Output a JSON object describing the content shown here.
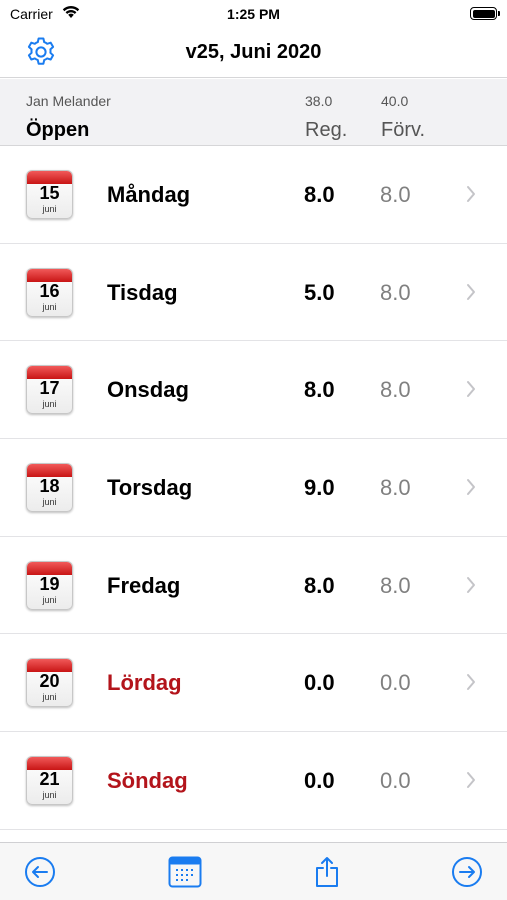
{
  "status_bar": {
    "carrier": "Carrier",
    "time": "1:25 PM"
  },
  "nav": {
    "title": "v25, Juni 2020"
  },
  "summary": {
    "name": "Jan Melander",
    "status": "Öppen",
    "reg_total": "38.0",
    "forv_total": "40.0",
    "reg_label": "Reg.",
    "forv_label": "Förv."
  },
  "days": [
    {
      "date": "15",
      "month": "juni",
      "name": "Måndag",
      "reg": "8.0",
      "forv": "8.0",
      "weekend": false
    },
    {
      "date": "16",
      "month": "juni",
      "name": "Tisdag",
      "reg": "5.0",
      "forv": "8.0",
      "weekend": false
    },
    {
      "date": "17",
      "month": "juni",
      "name": "Onsdag",
      "reg": "8.0",
      "forv": "8.0",
      "weekend": false
    },
    {
      "date": "18",
      "month": "juni",
      "name": "Torsdag",
      "reg": "9.0",
      "forv": "8.0",
      "weekend": false
    },
    {
      "date": "19",
      "month": "juni",
      "name": "Fredag",
      "reg": "8.0",
      "forv": "8.0",
      "weekend": false
    },
    {
      "date": "20",
      "month": "juni",
      "name": "Lördag",
      "reg": "0.0",
      "forv": "0.0",
      "weekend": true
    },
    {
      "date": "21",
      "month": "juni",
      "name": "Söndag",
      "reg": "0.0",
      "forv": "0.0",
      "weekend": true
    }
  ],
  "colors": {
    "accent": "#1a7cf0",
    "weekend": "#b3141b",
    "muted": "#808080"
  },
  "icons": {
    "settings": "gear-icon",
    "back": "arrow-left-circle-icon",
    "calendar": "calendar-icon",
    "share": "share-icon",
    "forward": "arrow-right-circle-icon",
    "chevron": "chevron-right-icon"
  }
}
